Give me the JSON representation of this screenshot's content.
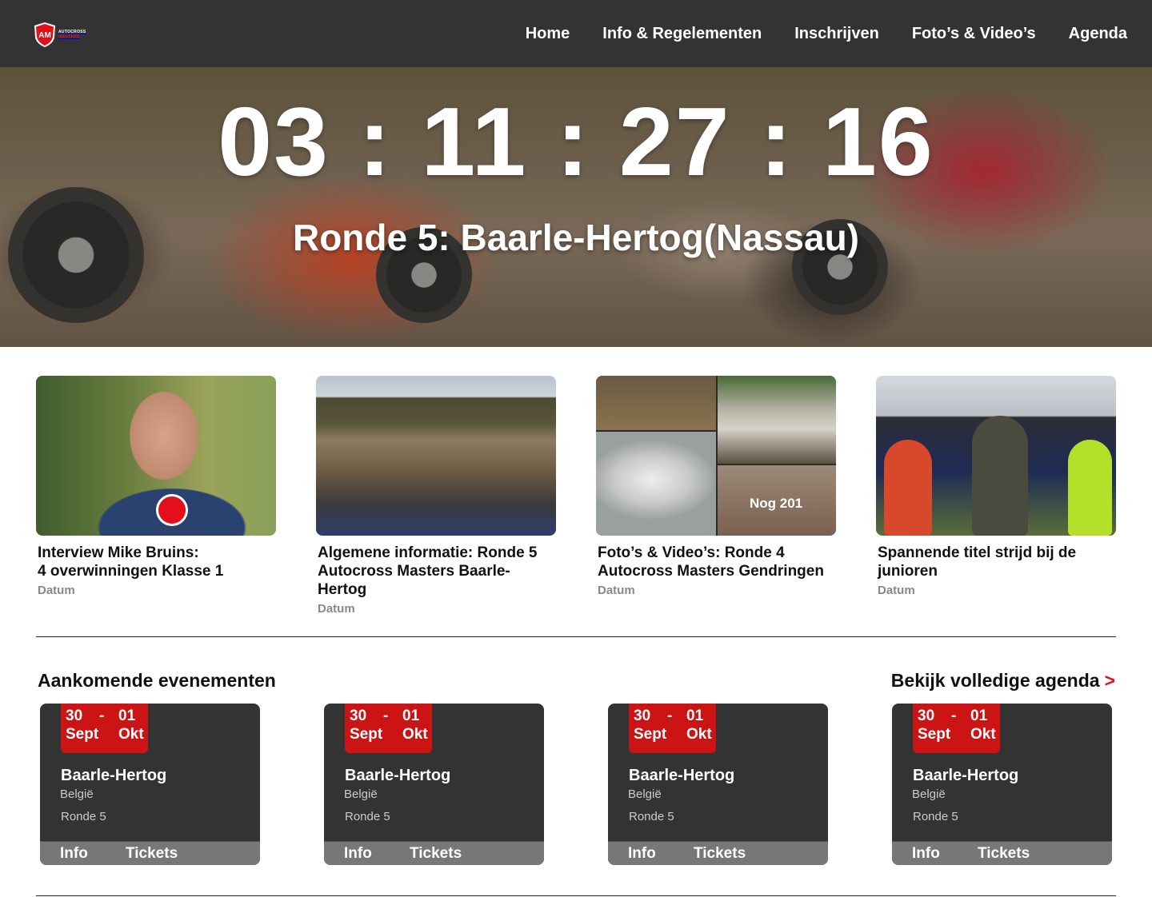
{
  "brand": {
    "logo_initials": "AM",
    "logo_line1": "AUTOCROSS",
    "logo_line2": "MASTERS"
  },
  "nav": {
    "items": [
      "Home",
      "Info & Regelementen",
      "Inschrijven",
      "Foto’s & Video’s",
      "Agenda"
    ]
  },
  "hero": {
    "countdown": {
      "days": "03",
      "hours": "11",
      "minutes": "27",
      "seconds": "16",
      "separator": ":"
    },
    "title": "Ronde 5: Baarle-Hertog(Nassau)"
  },
  "news": [
    {
      "title": "Interview Mike Bruins:\n4 overwinningen Klasse 1",
      "date": "Datum"
    },
    {
      "title": "Algemene informatie: Ronde 5 Autocross Masters Baarle-Hertog",
      "date": "Datum"
    },
    {
      "title": "Foto’s & Video’s: Ronde 4 Autocross Masters Gendringen",
      "date": "Datum",
      "overlay": "Nog 201"
    },
    {
      "title": "Spannende titel strijd bij de junioren",
      "date": "Datum"
    }
  ],
  "events": {
    "heading": "Aankomende evenementen",
    "agenda_link": "Bekijk volledige agenda",
    "agenda_arrow": ">",
    "items": [
      {
        "start_day": "30",
        "dash": "-",
        "end_day": "01",
        "start_month": "Sept",
        "end_month": "Okt",
        "city": "Baarle-Hertog",
        "country": "België",
        "round": "Ronde 5",
        "info": "Info",
        "tickets": "Tickets"
      },
      {
        "start_day": "30",
        "dash": "-",
        "end_day": "01",
        "start_month": "Sept",
        "end_month": "Okt",
        "city": "Baarle-Hertog",
        "country": "België",
        "round": "Ronde 5",
        "info": "Info",
        "tickets": "Tickets"
      },
      {
        "start_day": "30",
        "dash": "-",
        "end_day": "01",
        "start_month": "Sept",
        "end_month": "Okt",
        "city": "Baarle-Hertog",
        "country": "België",
        "round": "Ronde 5",
        "info": "Info",
        "tickets": "Tickets"
      },
      {
        "start_day": "30",
        "dash": "-",
        "end_day": "01",
        "start_month": "Sept",
        "end_month": "Okt",
        "city": "Baarle-Hertog",
        "country": "België",
        "round": "Ronde 5",
        "info": "Info",
        "tickets": "Tickets"
      }
    ]
  },
  "colors": {
    "nav_bg": "#333333",
    "accent_red": "#cc1414",
    "card_bg": "#333333",
    "card_actions_bg": "#777777",
    "date_text": "#888888"
  }
}
